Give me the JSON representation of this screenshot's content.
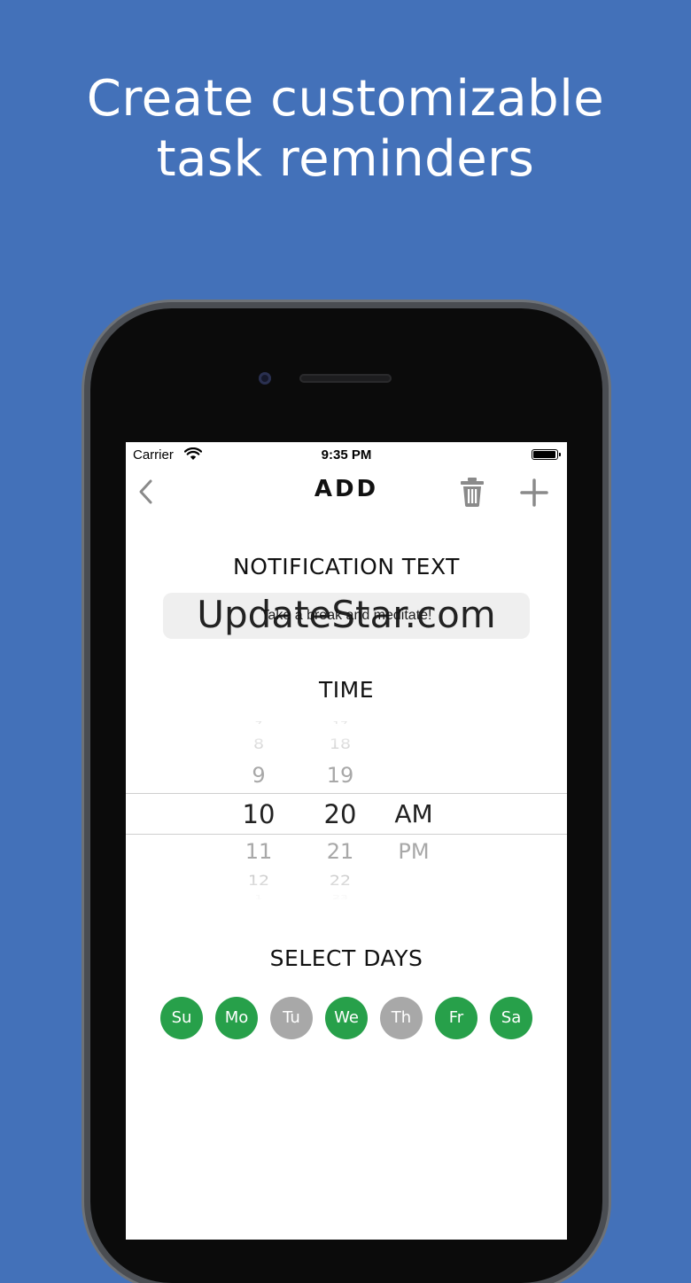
{
  "headline": {
    "line1": "Create customizable",
    "line2": "task reminders"
  },
  "status_bar": {
    "carrier": "Carrier",
    "time": "9:35 PM"
  },
  "nav": {
    "title": "ADD",
    "back_icon": "chevron-left-icon",
    "trash_icon": "trash-icon",
    "add_icon": "plus-icon"
  },
  "notification": {
    "label": "NOTIFICATION TEXT",
    "value": "Take a break and meditate!"
  },
  "watermark": "UpdateStar.com",
  "time": {
    "label": "TIME",
    "hours": [
      "7",
      "8",
      "9",
      "10",
      "11",
      "12",
      "1"
    ],
    "minutes": [
      "17",
      "18",
      "19",
      "20",
      "21",
      "22",
      "23"
    ],
    "periods": [
      "AM",
      "PM"
    ],
    "selected": {
      "hour": "10",
      "minute": "20",
      "period": "AM"
    }
  },
  "days": {
    "label": "SELECT DAYS",
    "items": [
      {
        "label": "Su",
        "selected": true
      },
      {
        "label": "Mo",
        "selected": true
      },
      {
        "label": "Tu",
        "selected": false
      },
      {
        "label": "We",
        "selected": true
      },
      {
        "label": "Th",
        "selected": false
      },
      {
        "label": "Fr",
        "selected": true
      },
      {
        "label": "Sa",
        "selected": true
      }
    ]
  },
  "colors": {
    "background": "#4371b9",
    "day_on": "#27a04a",
    "day_off": "#a8a8a8",
    "icon_gray": "#8a8a8a"
  }
}
